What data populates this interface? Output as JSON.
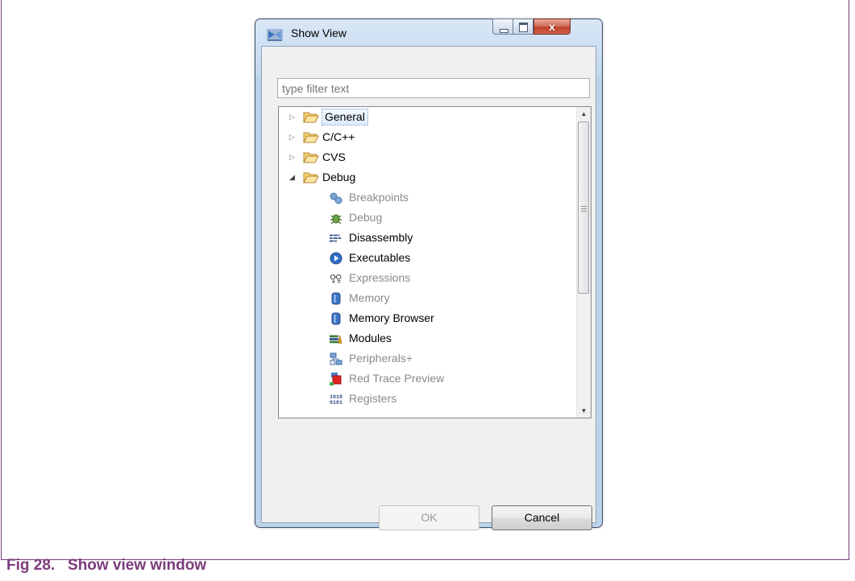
{
  "window": {
    "title": "Show View",
    "close_glyph": "x",
    "icon": "nxp-app-icon"
  },
  "filter": {
    "placeholder": "type filter text",
    "value": ""
  },
  "tree": {
    "categories": [
      {
        "label": "General",
        "expanded": false,
        "selected": true
      },
      {
        "label": "C/C++",
        "expanded": false
      },
      {
        "label": "CVS",
        "expanded": false
      },
      {
        "label": "Debug",
        "expanded": true
      }
    ],
    "debug_items": [
      {
        "label": "Breakpoints",
        "icon": "breakpoints-icon",
        "enabled": false
      },
      {
        "label": "Debug",
        "icon": "debug-bug-icon",
        "enabled": false
      },
      {
        "label": "Disassembly",
        "icon": "disassembly-icon",
        "enabled": true
      },
      {
        "label": "Executables",
        "icon": "executables-icon",
        "enabled": true
      },
      {
        "label": "Expressions",
        "icon": "expressions-icon",
        "enabled": false
      },
      {
        "label": "Memory",
        "icon": "memory-icon",
        "enabled": false
      },
      {
        "label": "Memory Browser",
        "icon": "memory-browser-icon",
        "enabled": true
      },
      {
        "label": "Modules",
        "icon": "modules-icon",
        "enabled": true
      },
      {
        "label": "Peripherals+",
        "icon": "peripherals-icon",
        "enabled": false
      },
      {
        "label": "Red Trace Preview",
        "icon": "red-trace-icon",
        "enabled": false
      },
      {
        "label": "Registers",
        "icon": "registers-icon",
        "enabled": false
      }
    ]
  },
  "buttons": {
    "ok": "OK",
    "cancel": "Cancel"
  },
  "caption": "Fig 28.   Show view window",
  "colors": {
    "caption": "#7a3b7a",
    "frame": "#7a3b7a",
    "selection": "#dcebfc"
  }
}
